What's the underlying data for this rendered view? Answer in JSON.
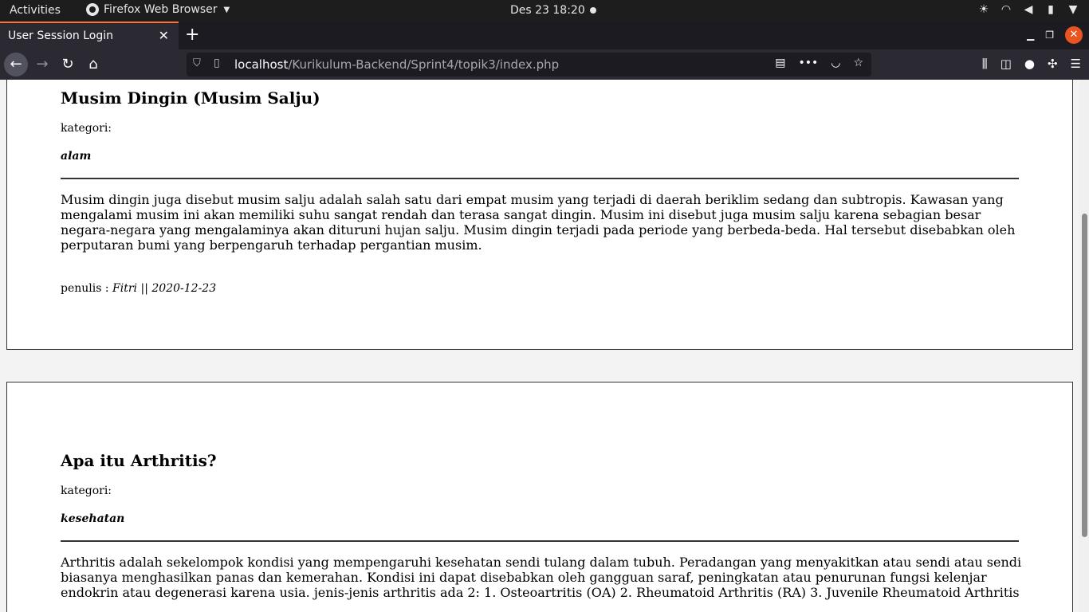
{
  "system_bar": {
    "activities": "Activities",
    "app_name": "Firefox Web Browser",
    "clock": "Des 23  18:20"
  },
  "browser": {
    "tab_title": "User Session Login",
    "url_host": "localhost",
    "url_path": "/Kurikulum-Backend/Sprint4/topik3/index.php"
  },
  "articles": [
    {
      "title": "Musim Dingin (Musim Salju)",
      "category_label": "kategori:",
      "category": "alam",
      "body": "Musim dingin juga disebut musim salju adalah salah satu dari empat musim yang terjadi di daerah beriklim sedang dan subtropis. Kawasan yang mengalami musim ini akan memiliki suhu sangat rendah dan terasa sangat dingin. Musim ini disebut juga musim salju karena sebagian besar negara-negara yang mengalaminya akan dituruni hujan salju. Musim dingin terjadi pada periode yang berbeda-beda. Hal tersebut disebabkan oleh perputaran bumi yang berpengaruh terhadap pergantian musim.",
      "author_label": "penulis :",
      "author": "Fitri",
      "separator": "||",
      "date": "2020-12-23"
    },
    {
      "title": "Apa itu Arthritis?",
      "category_label": "kategori:",
      "category": "kesehatan",
      "body": "Arthritis adalah sekelompok kondisi yang mempengaruhi kesehatan sendi tulang dalam tubuh. Peradangan yang menyakitkan atau sendi atau sendi biasanya menghasilkan panas dan kemerahan. Kondisi ini dapat disebabkan oleh gangguan saraf, peningkatan atau penurunan fungsi kelenjar endokrin atau degenerasi karena usia. jenis-jenis arthritis ada 2: 1. Osteoartritis (OA) 2. Rheumatoid Arthritis (RA) 3. Juvenile Rheumatoid Arthritis"
    }
  ]
}
